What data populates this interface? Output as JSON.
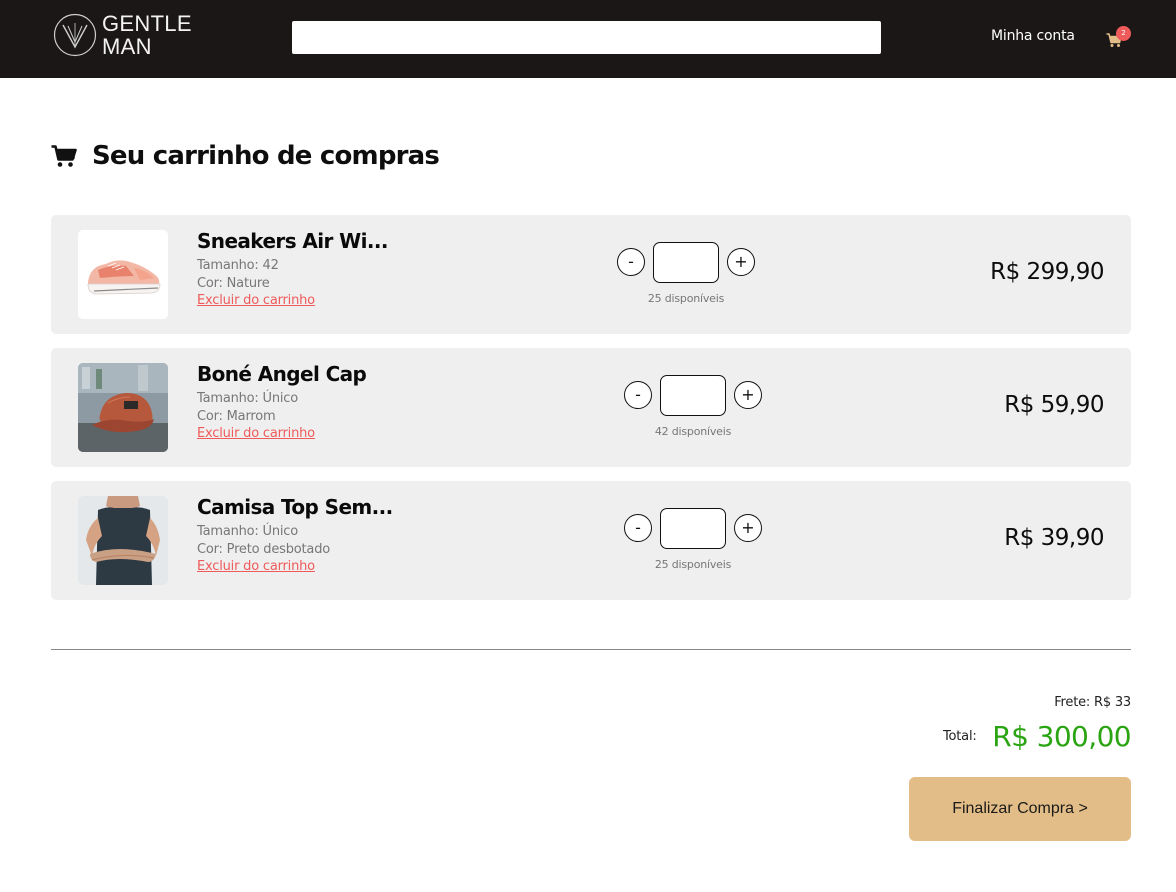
{
  "header": {
    "logo": {
      "line1": "GENTLE",
      "line2": "MAN",
      "icon": "logo-emblem-icon"
    },
    "search": {
      "value": "",
      "placeholder": ""
    },
    "account_label": "Minha conta",
    "cart": {
      "icon": "cart-icon",
      "count": "2"
    }
  },
  "page": {
    "title": "Seu carrinho de compras",
    "title_icon": "cart-icon"
  },
  "cart_items": [
    {
      "name": "Sneakers Air Wi...",
      "size": "Tamanho: 42",
      "color": "Cor: Nature",
      "remove_label": "Excluir do carrinho",
      "quantity": "",
      "stock": "25 disponíveis",
      "price": "R$ 299,90",
      "image": "sneaker-photo"
    },
    {
      "name": "Boné Angel Cap",
      "size": "Tamanho: Único",
      "color": "Cor: Marrom",
      "remove_label": "Excluir do carrinho",
      "quantity": "",
      "stock": "42 disponíveis",
      "price": "R$ 59,90",
      "image": "cap-photo"
    },
    {
      "name": "Camisa Top Sem...",
      "size": "Tamanho: Único",
      "color": "Cor: Preto desbotado",
      "remove_label": "Excluir do carrinho",
      "quantity": "",
      "stock": "25 disponíveis",
      "price": "R$ 39,90",
      "image": "shirt-photo"
    }
  ],
  "qty_controls": {
    "minus": "-",
    "plus": "+"
  },
  "summary": {
    "shipping": "Frete: R$ 33",
    "total_label": "Total:",
    "total_value": "R$ 300,00",
    "checkout_label": "Finalizar Compra >"
  },
  "colors": {
    "header_bg": "#1c1717",
    "item_bg": "#efefef",
    "remove_link": "#ef5a5a",
    "total": "#2aa412",
    "checkout_button": "#e3bd87",
    "badge": "#ef5a5a"
  }
}
